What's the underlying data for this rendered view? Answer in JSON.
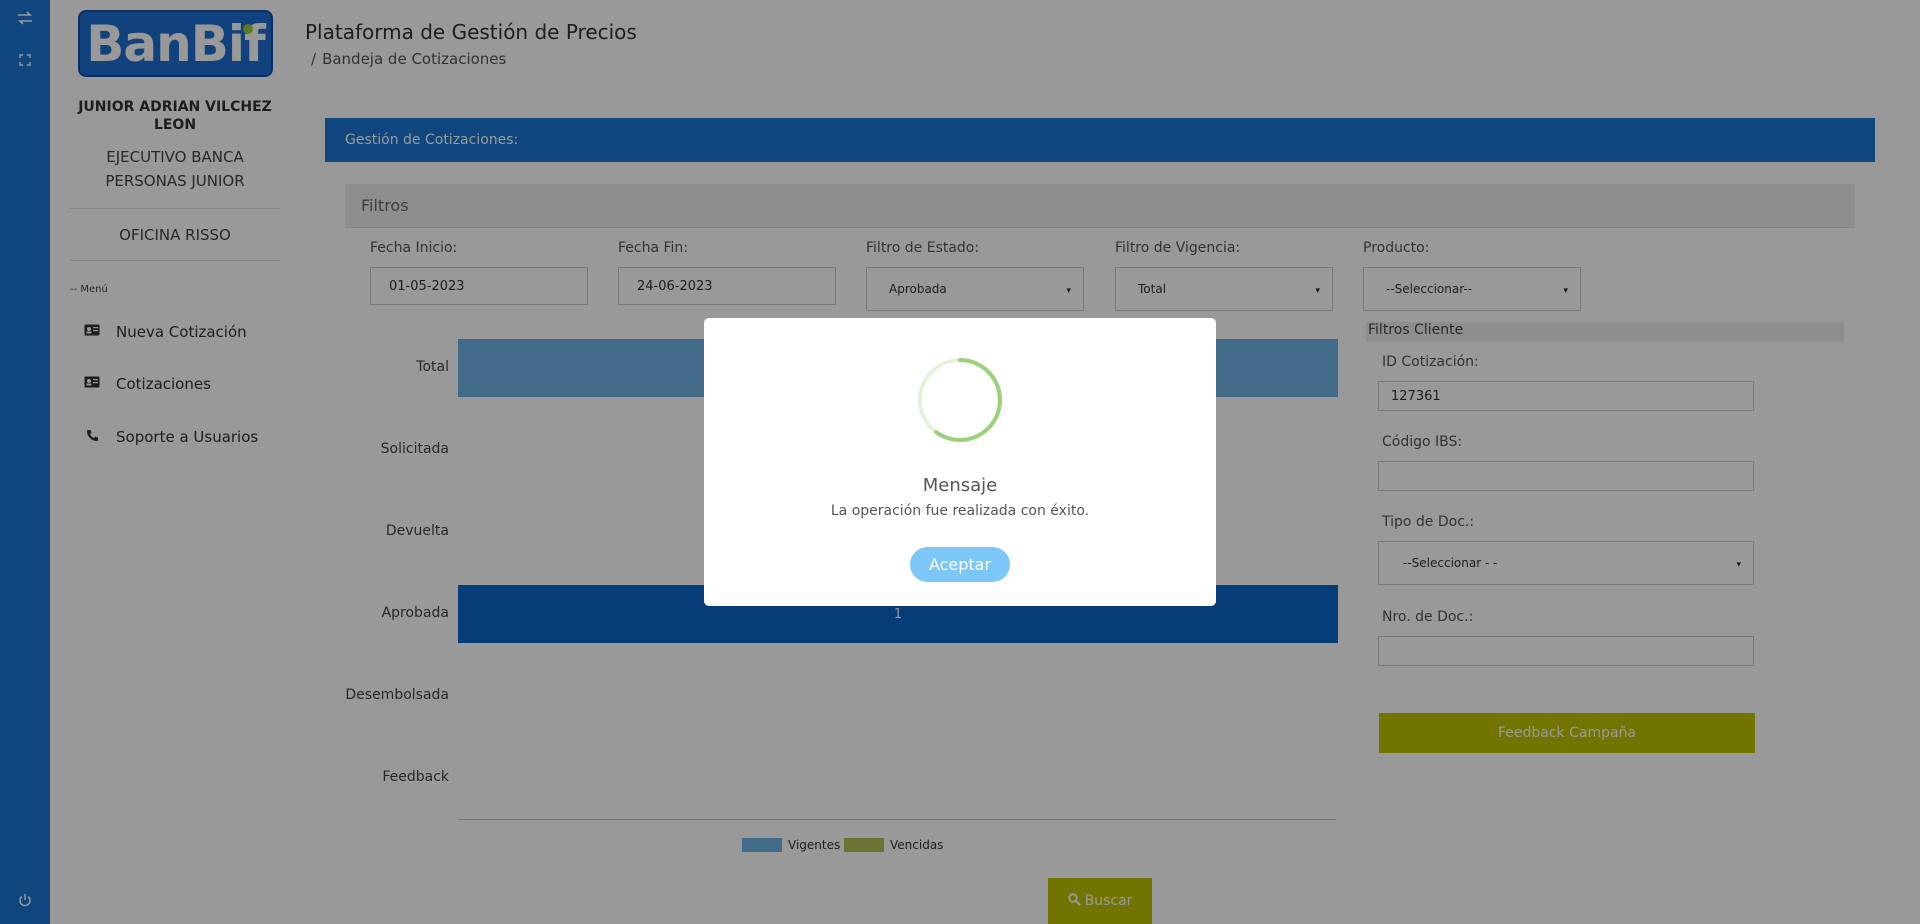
{
  "rail": {
    "icons": [
      "swap-arrows-icon",
      "expand-icon",
      "power-icon"
    ]
  },
  "sidebar": {
    "logo_text": "BanBif",
    "user_name": "JUNIOR ADRIAN VILCHEZ LEON",
    "user_role": "EJECUTIVO BANCA PERSONAS JUNIOR",
    "office": "OFICINA RISSO",
    "menu_title": "-- Menú",
    "items": [
      {
        "label": "Nueva Cotización",
        "icon": "id-card-icon"
      },
      {
        "label": "Cotizaciones",
        "icon": "id-card-icon"
      },
      {
        "label": "Soporte a Usuarios",
        "icon": "phone-icon"
      }
    ]
  },
  "header": {
    "title": "Plataforma de Gestión de Precios",
    "breadcrumb_sep": "/",
    "breadcrumb": "Bandeja de Cotizaciones"
  },
  "main": {
    "card_title": "Gestión de Cotizaciones:",
    "filters_title": "Filtros",
    "fecha_inicio_label": "Fecha Inicio:",
    "fecha_inicio_value": "01-05-2023",
    "fecha_fin_label": "Fecha Fin:",
    "fecha_fin_value": "24-06-2023",
    "estado_label": "Filtro de Estado:",
    "estado_value": "Aprobada",
    "vigencia_label": "Filtro de Vigencia:",
    "vigencia_value": "Total",
    "producto_label": "Producto:",
    "producto_value": "--Seleccionar--",
    "client_filters_title": "Filtros Cliente",
    "id_cotizacion_label": "ID Cotización:",
    "id_cotizacion_value": "127361",
    "codigo_ibs_label": "Código IBS:",
    "codigo_ibs_value": "",
    "tipo_doc_label": "Tipo de Doc.:",
    "tipo_doc_value": "--Seleccionar - -",
    "nro_doc_label": "Nro. de Doc.:",
    "nro_doc_value": "",
    "feedback_button": "Feedback Campaña",
    "buscar_button": "Buscar"
  },
  "chart_data": {
    "type": "bar",
    "orientation": "horizontal",
    "categories": [
      "Total",
      "Solicitada",
      "Devuelta",
      "Aprobada",
      "Desembolsada",
      "Feedback"
    ],
    "bar_labels": [
      "",
      "",
      "",
      "1",
      "",
      ""
    ],
    "bar_colors": [
      "#6fb3e6",
      "",
      "",
      "#0b66c8",
      "",
      ""
    ],
    "legend": [
      {
        "name": "Vigentes",
        "color": "#6fb3e6"
      },
      {
        "name": "Vencidas",
        "color": "#b4bf55"
      }
    ]
  },
  "modal": {
    "title": "Mensaje",
    "text": "La operación fue realizada con éxito.",
    "button": "Aceptar"
  },
  "colors": {
    "primary": "#1976d2",
    "accent_button": "#bdc400",
    "modal_button": "#7cc7f7",
    "spinner": "#9ad27a"
  }
}
